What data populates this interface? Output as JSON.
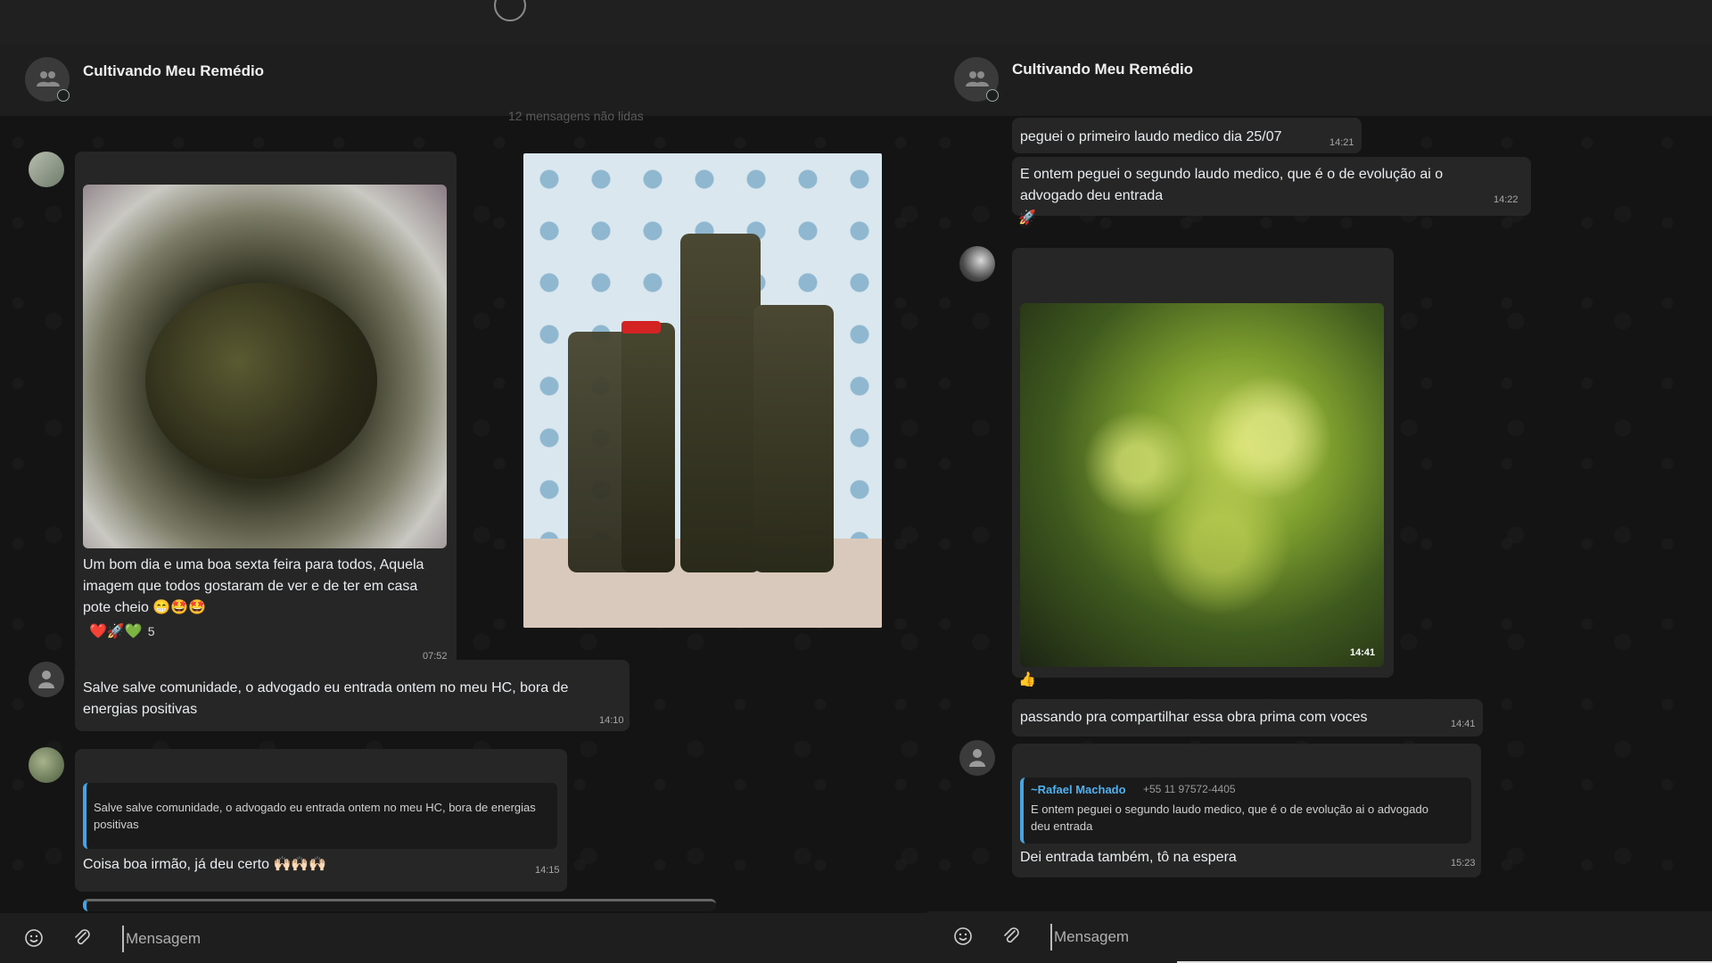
{
  "left_chat": {
    "group_name": "Cultivando Meu Remédio",
    "unread_label": "12 mensagens não lidas",
    "messages": {
      "m1_text": "Um bom dia e uma boa sexta feira para todos, Aquela imagem que todos gostaram de ver e de ter em casa pote cheio 😁🤩🤩",
      "m1_time": "07:52",
      "m1_reactions": "❤️🚀💚",
      "m1_reaction_count": "5",
      "m2_text": "Salve salve comunidade, o advogado eu entrada ontem no meu HC, bora de energias positivas",
      "m2_time": "14:10",
      "m3_quote": "Salve salve comunidade, o advogado eu entrada ontem no meu HC, bora de energias positivas",
      "m3_text": "Coisa boa irmão, já deu certo 🙌🏻🙌🏻🙌🏻",
      "m3_time": "14:15"
    },
    "composer_placeholder": "Mensagem"
  },
  "right_chat": {
    "group_name": "Cultivando Meu Remédio",
    "messages": {
      "r1_text": "peguei o primeiro laudo medico dia 25/07",
      "r1_time": "14:21",
      "r2_text": "E ontem peguei o segundo laudo medico, que é o de evolução ai o advogado deu entrada",
      "r2_time": "14:22",
      "r2_reaction": "🚀",
      "r3_image_time": "14:41",
      "r3_reaction": "👍",
      "r4_text": "passando pra compartilhar essa obra prima com voces",
      "r4_time": "14:41",
      "r5_quote_author": "~Rafael Machado",
      "r5_quote_phone": "+55 11 97572-4405",
      "r5_quote_text": "E ontem peguei o segundo laudo medico, que é o de evolução ai o advogado deu entrada",
      "r5_text": "Dei entrada também, tô na espera",
      "r5_time": "15:23"
    },
    "composer_placeholder": "Mensagem"
  },
  "icons": [
    "group-icon",
    "emoji-icon",
    "attach-icon",
    "user-icon"
  ]
}
